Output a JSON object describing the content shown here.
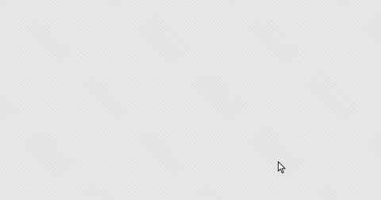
{
  "desktop": {
    "background_color": "#e4e4e4",
    "pattern": "fine-diagonal-crosshatch"
  },
  "cursor": {
    "icon": "arrow-pointer-icon",
    "fill_color": "#ffffff",
    "stroke_color": "#222222"
  }
}
